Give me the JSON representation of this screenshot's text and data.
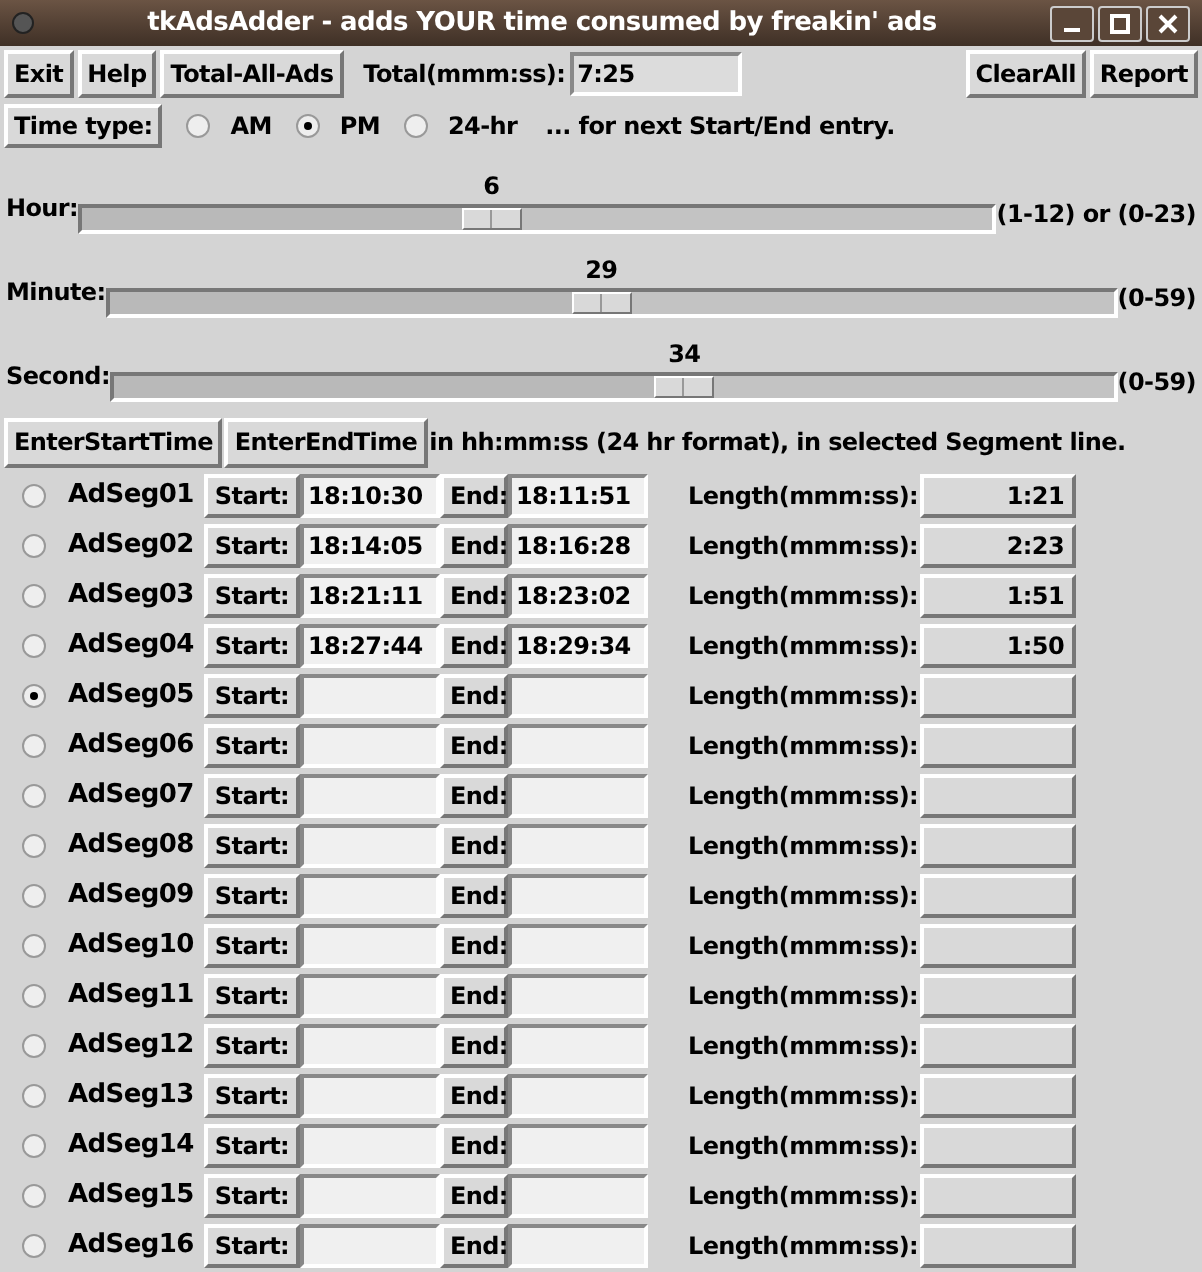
{
  "window": {
    "title": "tkAdsAdder - adds YOUR time consumed by freakin' ads"
  },
  "toolbar": {
    "buttons": [
      "Exit",
      "Help",
      "Total-All-Ads"
    ],
    "total_label": "Total(mmm:ss):",
    "total_value": "7:25",
    "right_buttons": [
      "ClearAll",
      "Report"
    ]
  },
  "time_type": {
    "button": "Time type:",
    "options": [
      {
        "label": "AM",
        "selected": false
      },
      {
        "label": "PM",
        "selected": true
      },
      {
        "label": "24-hr",
        "selected": false
      }
    ],
    "note": "... for next Start/End entry."
  },
  "sliders": [
    {
      "label": "Hour:",
      "value": "6",
      "level": 0.45,
      "range": "(1-12) or (0-23)"
    },
    {
      "label": "Minute:",
      "value": "29",
      "level": 0.49,
      "range": "(0-59)"
    },
    {
      "label": "Second:",
      "value": "34",
      "level": 0.57,
      "range": "(0-59)"
    }
  ],
  "entry_buttons": [
    "EnterStartTime",
    "EnterEndTime"
  ],
  "entry_note": "in hh:mm:ss (24 hr format), in selected Segment line.",
  "segments": [
    {
      "name": "AdSeg01",
      "selected": false,
      "start_button": "Start:",
      "start": "18:10:30",
      "end_button": "End:",
      "end": "18:11:51",
      "length_label": "Length(mmm:ss):",
      "length": "1:21"
    },
    {
      "name": "AdSeg02",
      "selected": false,
      "start_button": "Start:",
      "start": "18:14:05",
      "end_button": "End:",
      "end": "18:16:28",
      "length_label": "Length(mmm:ss):",
      "length": "2:23"
    },
    {
      "name": "AdSeg03",
      "selected": false,
      "start_button": "Start:",
      "start": "18:21:11",
      "end_button": "End:",
      "end": "18:23:02",
      "length_label": "Length(mmm:ss):",
      "length": "1:51"
    },
    {
      "name": "AdSeg04",
      "selected": false,
      "start_button": "Start:",
      "start": "18:27:44",
      "end_button": "End:",
      "end": "18:29:34",
      "length_label": "Length(mmm:ss):",
      "length": "1:50"
    },
    {
      "name": "AdSeg05",
      "selected": true,
      "start_button": "Start:",
      "end_button": "End:",
      "length_label": "Length(mmm:ss):"
    },
    {
      "name": "AdSeg06",
      "selected": false,
      "start_button": "Start:",
      "end_button": "End:",
      "length_label": "Length(mmm:ss):"
    },
    {
      "name": "AdSeg07",
      "selected": false,
      "start_button": "Start:",
      "end_button": "End:",
      "length_label": "Length(mmm:ss):"
    },
    {
      "name": "AdSeg08",
      "selected": false,
      "start_button": "Start:",
      "end_button": "End:",
      "length_label": "Length(mmm:ss):"
    },
    {
      "name": "AdSeg09",
      "selected": false,
      "start_button": "Start:",
      "end_button": "End:",
      "length_label": "Length(mmm:ss):"
    },
    {
      "name": "AdSeg10",
      "selected": false,
      "start_button": "Start:",
      "end_button": "End:",
      "length_label": "Length(mmm:ss):"
    },
    {
      "name": "AdSeg11",
      "selected": false,
      "start_button": "Start:",
      "end_button": "End:",
      "length_label": "Length(mmm:ss):"
    },
    {
      "name": "AdSeg12",
      "selected": false,
      "start_button": "Start:",
      "end_button": "End:",
      "length_label": "Length(mmm:ss):"
    },
    {
      "name": "AdSeg13",
      "selected": false,
      "start_button": "Start:",
      "end_button": "End:",
      "length_label": "Length(mmm:ss):"
    },
    {
      "name": "AdSeg14",
      "selected": false,
      "start_button": "Start:",
      "end_button": "End:",
      "length_label": "Length(mmm:ss):"
    },
    {
      "name": "AdSeg15",
      "selected": false,
      "start_button": "Start:",
      "end_button": "End:",
      "length_label": "Length(mmm:ss):"
    },
    {
      "name": "AdSeg16",
      "selected": false,
      "start_button": "Start:",
      "end_button": "End:",
      "length_label": "Length(mmm:ss):"
    }
  ]
}
